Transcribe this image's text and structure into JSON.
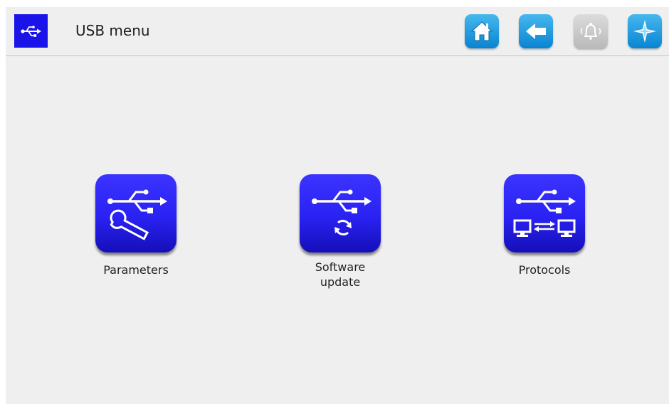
{
  "header": {
    "title": "USB menu",
    "mode_icon": "usb-icon",
    "buttons": [
      {
        "name": "home",
        "icon": "home-icon",
        "enabled": true
      },
      {
        "name": "back",
        "icon": "back-arrow-icon",
        "enabled": true
      },
      {
        "name": "alarm",
        "icon": "bell-icon",
        "enabled": false
      },
      {
        "name": "navigation",
        "icon": "compass-star-icon",
        "enabled": true
      }
    ]
  },
  "tiles": [
    {
      "label": "Parameters",
      "icon": "usb-wrench-icon"
    },
    {
      "label_line1": "Software",
      "label_line2": "update",
      "icon": "usb-refresh-icon"
    },
    {
      "label": "Protocols",
      "icon": "usb-transfer-icon"
    }
  ],
  "colors": {
    "accent": "#1a14e8",
    "header_button_blue": "#1a98e0",
    "disabled_gray": "#c8c8c8",
    "background": "#efefef"
  }
}
